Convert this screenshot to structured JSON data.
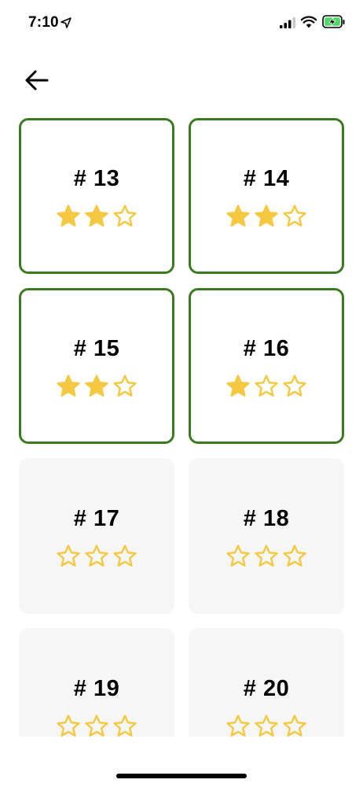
{
  "status_bar": {
    "time": "7:10",
    "location_icon": "location-arrow-icon",
    "signal_icon": "cellular-signal-icon",
    "wifi_icon": "wifi-icon",
    "battery_icon": "battery-charging-icon"
  },
  "nav": {
    "back_icon": "arrow-left-icon"
  },
  "colors": {
    "unlocked_border": "#3b7a22",
    "locked_background": "#f6f6f6",
    "star": "#f5c842",
    "battery_fill": "#4cd964"
  },
  "levels": [
    {
      "label": "# 13",
      "stars_earned": 2,
      "stars_total": 3,
      "unlocked": true
    },
    {
      "label": "# 14",
      "stars_earned": 2,
      "stars_total": 3,
      "unlocked": true
    },
    {
      "label": "# 15",
      "stars_earned": 2,
      "stars_total": 3,
      "unlocked": true
    },
    {
      "label": "# 16",
      "stars_earned": 1,
      "stars_total": 3,
      "unlocked": true
    },
    {
      "label": "# 17",
      "stars_earned": 0,
      "stars_total": 3,
      "unlocked": false
    },
    {
      "label": "# 18",
      "stars_earned": 0,
      "stars_total": 3,
      "unlocked": false
    },
    {
      "label": "# 19",
      "stars_earned": 0,
      "stars_total": 3,
      "unlocked": false
    },
    {
      "label": "# 20",
      "stars_earned": 0,
      "stars_total": 3,
      "unlocked": false
    }
  ]
}
